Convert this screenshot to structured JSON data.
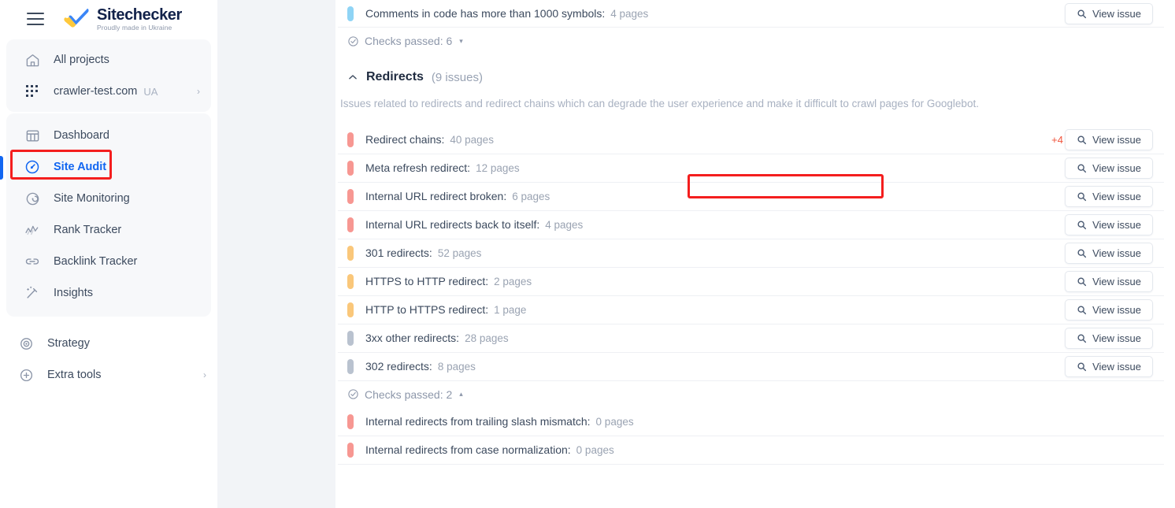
{
  "sidebar": {
    "menu_icon": "hamburger-icon",
    "brand": {
      "title": "Sitechecker",
      "tagline": "Proudly made in Ukraine",
      "logo_icon": "ukraine-checkmark-logo"
    },
    "projects": [
      {
        "label": "All projects",
        "icon": "home-icon",
        "badge": "",
        "chevron": ""
      },
      {
        "label": "crawler-test.com",
        "icon": "grid-dots-icon",
        "badge": "UA",
        "chevron": "›"
      }
    ],
    "nav": [
      {
        "label": "Dashboard",
        "icon": "dashboard-icon",
        "active": false,
        "chevron": ""
      },
      {
        "label": "Site Audit",
        "icon": "site-audit-icon",
        "active": true,
        "chevron": ""
      },
      {
        "label": "Site Monitoring",
        "icon": "site-monitoring-icon",
        "active": false,
        "chevron": ""
      },
      {
        "label": "Rank Tracker",
        "icon": "rank-tracker-icon",
        "active": false,
        "chevron": ""
      },
      {
        "label": "Backlink Tracker",
        "icon": "backlink-icon",
        "active": false,
        "chevron": ""
      },
      {
        "label": "Insights",
        "icon": "insights-wand-icon",
        "active": false,
        "chevron": ""
      }
    ],
    "tools": [
      {
        "label": "Strategy",
        "icon": "target-icon",
        "chevron": ""
      },
      {
        "label": "Extra tools",
        "icon": "plus-circle-icon",
        "chevron": "›"
      }
    ]
  },
  "main": {
    "top_issue": {
      "name": "Comments in code has more than 1000 symbols:",
      "count": "4 pages",
      "severity": "info",
      "button": "View issue"
    },
    "checks_passed_top": {
      "label": "Checks passed: 6",
      "caret": "▾"
    },
    "section": {
      "title": "Redirects",
      "count": "(9 issues)",
      "description": "Issues related to redirects and redirect chains which can degrade the user experience and make it difficult to crawl pages for Googlebot.",
      "collapse_icon": "chevron-up-icon"
    },
    "button_label": "View issue",
    "search_icon": "magnifier-icon",
    "issues": [
      {
        "name": "Redirect chains:",
        "count": "40 pages",
        "severity": "critical",
        "extra": "+4"
      },
      {
        "name": "Meta refresh redirect:",
        "count": "12 pages",
        "severity": "critical",
        "extra": ""
      },
      {
        "name": "Internal URL redirect broken:",
        "count": "6 pages",
        "severity": "critical",
        "extra": ""
      },
      {
        "name": "Internal URL redirects back to itself:",
        "count": "4 pages",
        "severity": "critical",
        "extra": ""
      },
      {
        "name": "301 redirects:",
        "count": "52 pages",
        "severity": "warning",
        "extra": ""
      },
      {
        "name": "HTTPS to HTTP redirect:",
        "count": "2 pages",
        "severity": "warning",
        "extra": ""
      },
      {
        "name": "HTTP to HTTPS redirect:",
        "count": "1 page",
        "severity": "warning",
        "extra": ""
      },
      {
        "name": "3xx other redirects:",
        "count": "28 pages",
        "severity": "notice",
        "extra": ""
      },
      {
        "name": "302 redirects:",
        "count": "8 pages",
        "severity": "notice",
        "extra": ""
      }
    ],
    "checks_passed_bottom": {
      "label": "Checks passed: 2",
      "caret": "▴"
    },
    "passed_issues": [
      {
        "name": "Internal redirects from trailing slash mismatch:",
        "count": "0 pages",
        "severity": "critical"
      },
      {
        "name": "Internal redirects from case normalization:",
        "count": "0 pages",
        "severity": "critical"
      }
    ]
  },
  "annotations": {
    "highlight_color": "#f41e1e",
    "highlighted_elements": [
      "Site Audit",
      "Meta refresh redirect"
    ]
  },
  "colors": {
    "accent": "#1266f1",
    "critical": "#f79792",
    "warning": "#fac77a",
    "notice": "#b9c2cf",
    "info": "#8fd4f5",
    "plus_badge": "#f0543c"
  }
}
